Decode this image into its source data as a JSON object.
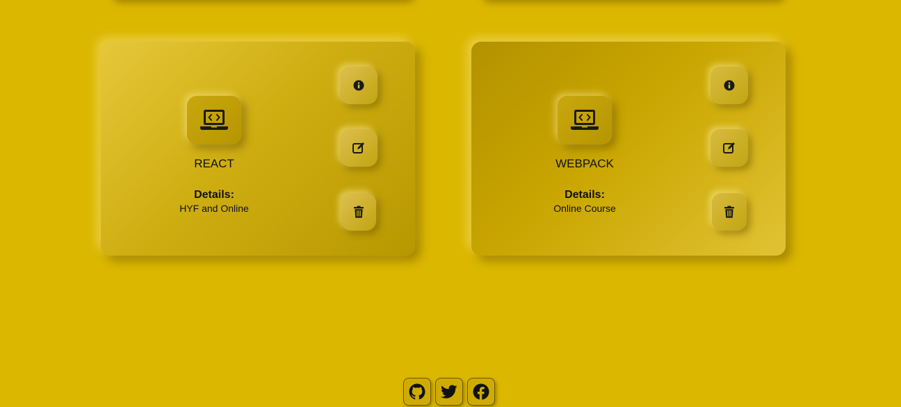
{
  "colors": {
    "background": "#dcb700",
    "icon": "#1a1a1a"
  },
  "courses": [
    {
      "title": "REACT",
      "details_label": "Details:",
      "details_value": "HYF and Online",
      "icon": "laptop-code-icon"
    },
    {
      "title": "WEBPACK",
      "details_label": "Details:",
      "details_value": "Online Course",
      "icon": "laptop-code-icon"
    }
  ],
  "actions": {
    "info_icon": "info-circle-icon",
    "edit_icon": "edit-icon",
    "delete_icon": "trash-icon"
  },
  "footer": {
    "social": [
      {
        "name": "github",
        "icon": "github-icon"
      },
      {
        "name": "twitter",
        "icon": "twitter-icon"
      },
      {
        "name": "facebook",
        "icon": "facebook-icon"
      }
    ]
  }
}
